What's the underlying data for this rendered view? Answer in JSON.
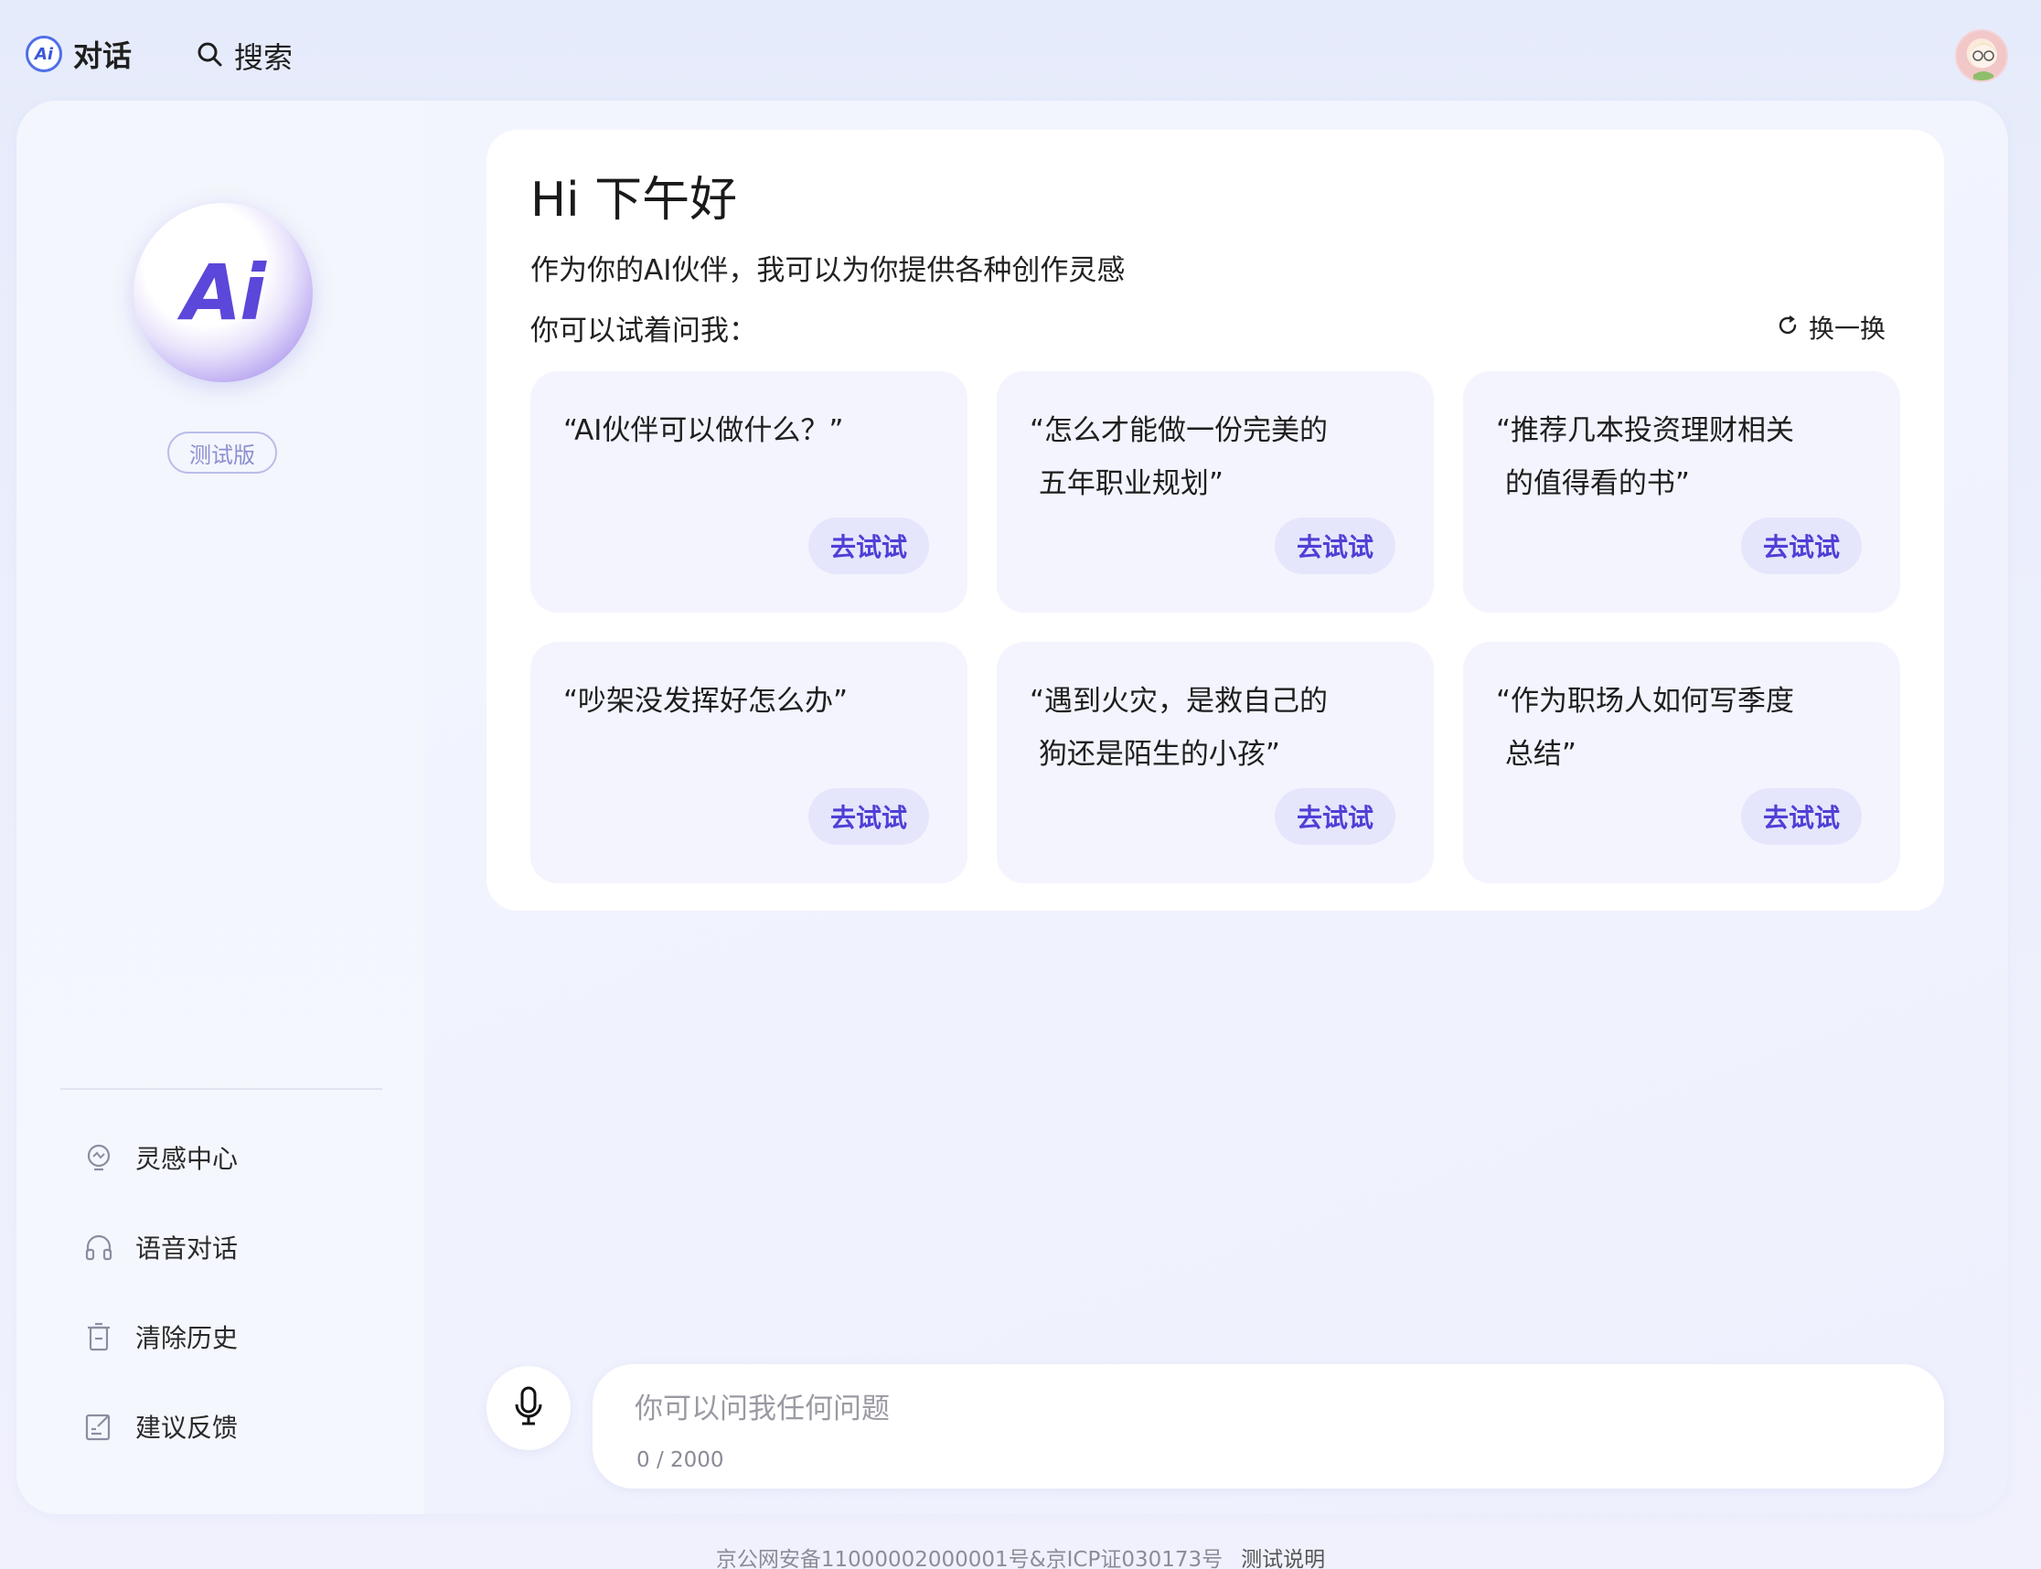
{
  "header": {
    "brand_logo_text": "Ai",
    "brand_label": "对话",
    "search_label": "搜索"
  },
  "sidebar": {
    "orb_text": "Ai",
    "badge": "测试版",
    "items": [
      {
        "label": "灵感中心",
        "icon": "lightbulb-icon"
      },
      {
        "label": "语音对话",
        "icon": "headphones-icon"
      },
      {
        "label": "清除历史",
        "icon": "trash-icon"
      },
      {
        "label": "建议反馈",
        "icon": "feedback-icon"
      }
    ]
  },
  "greeting": {
    "title": "Hi 下午好",
    "subtitle": "作为你的AI伙伴，我可以为你提供各种创作灵感",
    "try_label": "你可以试着问我：",
    "refresh_label": "换一换"
  },
  "suggestions": [
    {
      "text": "“AI伙伴可以做什么？”",
      "button": "去试试"
    },
    {
      "text": "“怎么才能做一份完美的\n 五年职业规划”",
      "button": "去试试"
    },
    {
      "text": "“推荐几本投资理财相关\n 的值得看的书”",
      "button": "去试试"
    },
    {
      "text": "“吵架没发挥好怎么办”",
      "button": "去试试"
    },
    {
      "text": "“遇到火灾，是救自己的\n 狗还是陌生的小孩”",
      "button": "去试试"
    },
    {
      "text": "“作为职场人如何写季度\n 总结”",
      "button": "去试试"
    }
  ],
  "input": {
    "placeholder": "你可以问我任何问题",
    "value": "",
    "char_count": "0 / 2000"
  },
  "footer": {
    "icp": "京公网安备11000002000001号&京ICP证030173号",
    "link": "测试说明"
  },
  "colors": {
    "accent": "#4f3fd6",
    "chip_bg": "#e5e6fc",
    "card_bg": "#f3f4fd"
  }
}
